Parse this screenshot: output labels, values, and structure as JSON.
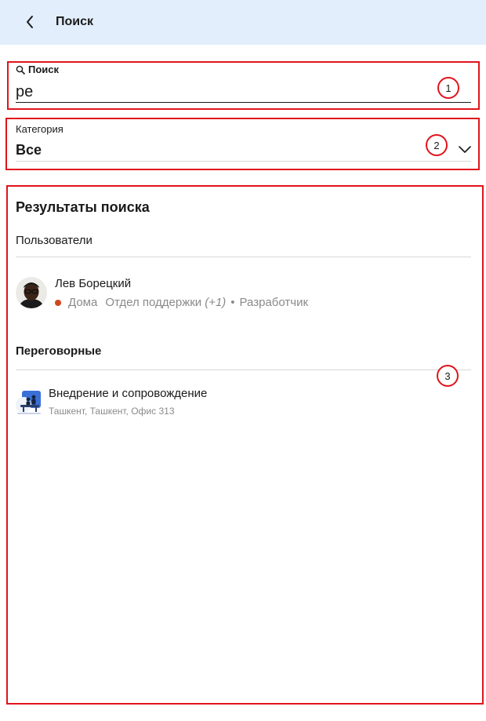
{
  "header": {
    "title": "Поиск",
    "back_icon": "chevron-left-icon"
  },
  "search": {
    "label": "Поиск",
    "icon": "search-icon",
    "value": "ре",
    "badge": "1"
  },
  "category": {
    "label": "Категория",
    "value": "Все",
    "icon": "chevron-down-icon",
    "badge": "2"
  },
  "results": {
    "title": "Результаты поиска",
    "badge": "3",
    "users_section": "Пользователи",
    "user": {
      "name": "Лев Борецкий",
      "status_text": "Дома",
      "status_color": "#d2461c",
      "department": "Отдел поддержки",
      "department_extra": "(+1)",
      "separator": "•",
      "role": "Разработчик"
    },
    "rooms_section": "Переговорные",
    "room": {
      "name": "Внедрение и сопровождение",
      "location": "Ташкент, Ташкент, Офис 313"
    }
  },
  "colors": {
    "header_bg": "#e3eefc",
    "annotation": "#e0141b"
  }
}
